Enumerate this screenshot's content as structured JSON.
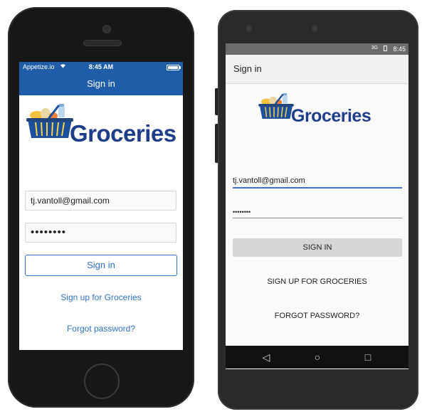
{
  "ios": {
    "status": {
      "carrier": "Appetize.io",
      "time": "8:45 AM"
    },
    "nav_title": "Sign in",
    "logo_text": "Groceries",
    "email_value": "tj.vantoll@gmail.com",
    "password_value": "••••••••",
    "signin_label": "Sign in",
    "signup_link": "Sign up for Groceries",
    "forgot_link": "Forgot password?"
  },
  "android": {
    "status": {
      "time": "8:45",
      "network": "3G"
    },
    "toolbar_title": "Sign in",
    "logo_text": "Groceries",
    "email_value": "tj.vantoll@gmail.com",
    "password_value": "••••••••",
    "signin_label": "SIGN IN",
    "signup_link": "SIGN UP FOR GROCERIES",
    "forgot_link": "FORGOT PASSWORD?",
    "nav": {
      "back": "◁",
      "home": "○",
      "recents": "□"
    }
  },
  "colors": {
    "ios_bar": "#1f5da8",
    "ios_link": "#2f74c4",
    "logo_text": "#1f3e8a",
    "basket": "#1c4f9c",
    "android_field_line": "#3f6fd6",
    "android_button": "#d6d6d6"
  },
  "icons": {
    "ios_wifi": "wifi-icon",
    "ios_battery": "battery-icon",
    "android_signal": "signal-icon",
    "android_battery": "battery-icon",
    "logo": "grocery-basket-icon"
  }
}
